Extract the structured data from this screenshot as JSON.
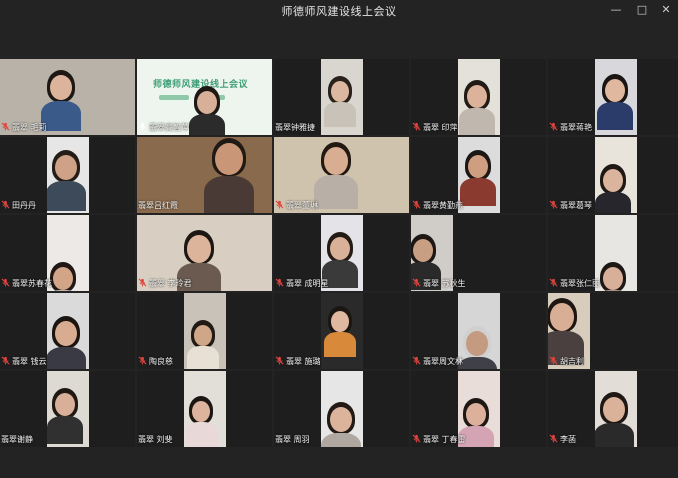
{
  "window": {
    "title": "师德师风建设线上会议",
    "minimize_icon": "minimize-icon",
    "maximize_icon": "maximize-icon",
    "close_icon": "close-icon"
  },
  "slide": {
    "title": "师德师风建设线上会议"
  },
  "colors": {
    "background": "#232323",
    "tile": "#1e1e1e",
    "mic_off": "#e0443e",
    "mic_on": "#ffffff"
  },
  "participants": [
    {
      "name": "翡翠 毛莉",
      "mic": "muted"
    },
    {
      "name": "翡翠高智萍",
      "mic": "active"
    },
    {
      "name": "翡翠钟雅捷",
      "mic": "none"
    },
    {
      "name": "翡翠 印萍",
      "mic": "muted"
    },
    {
      "name": "翡翠蒋艳",
      "mic": "muted"
    },
    {
      "name": "田丹丹",
      "mic": "muted"
    },
    {
      "name": "翡翠吕红霞",
      "mic": "none"
    },
    {
      "name": "翡翠董琳",
      "mic": "muted"
    },
    {
      "name": "翡翠黄勤燕",
      "mic": "muted"
    },
    {
      "name": "翡翠葛琴",
      "mic": "muted"
    },
    {
      "name": "翡翠苏春花",
      "mic": "muted"
    },
    {
      "name": "翡翠 李玲君",
      "mic": "muted"
    },
    {
      "name": "翡翠 成明星",
      "mic": "muted"
    },
    {
      "name": "翡翠 苏秋生",
      "mic": "muted"
    },
    {
      "name": "翡翠张仁丽",
      "mic": "muted"
    },
    {
      "name": "翡翠 钱云",
      "mic": "muted"
    },
    {
      "name": "陶良慈",
      "mic": "muted"
    },
    {
      "name": "翡翠 施璐",
      "mic": "muted"
    },
    {
      "name": "翡翠周文林",
      "mic": "muted"
    },
    {
      "name": "胡吉利",
      "mic": "muted"
    },
    {
      "name": "翡翠谢静",
      "mic": "none"
    },
    {
      "name": "翡翠 刘斐",
      "mic": "none"
    },
    {
      "name": "翡翠 周羽",
      "mic": "none"
    },
    {
      "name": "翡翠 丁春雷",
      "mic": "muted"
    },
    {
      "name": "李菡",
      "mic": "muted"
    }
  ]
}
